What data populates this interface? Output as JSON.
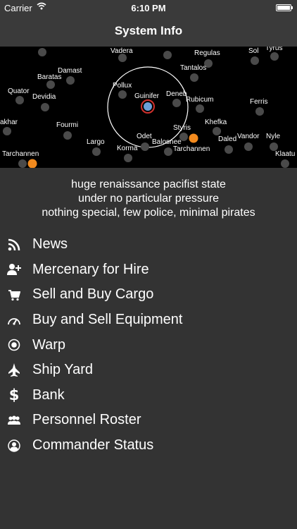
{
  "status_bar": {
    "carrier": "Carrier",
    "time": "6:10 PM",
    "wifi_icon": "wifi-icon",
    "battery_icon": "battery-icon"
  },
  "nav": {
    "title": "System Info"
  },
  "map": {
    "current_system": "Guinifer",
    "systems": [
      {
        "name": "Vadera"
      },
      {
        "name": "Regulas"
      },
      {
        "name": "Sol"
      },
      {
        "name": "Tyrus"
      },
      {
        "name": "Damast"
      },
      {
        "name": "Baratas"
      },
      {
        "name": "Tantalos"
      },
      {
        "name": "Pollux"
      },
      {
        "name": "Quator"
      },
      {
        "name": "Devidia"
      },
      {
        "name": "Guinifer"
      },
      {
        "name": "Deneb"
      },
      {
        "name": "Rubicum"
      },
      {
        "name": "Ferris"
      },
      {
        "name": "akhar"
      },
      {
        "name": "Fourmi"
      },
      {
        "name": "Khefka"
      },
      {
        "name": "Styris"
      },
      {
        "name": "Odet"
      },
      {
        "name": "Vandor"
      },
      {
        "name": "Nyle"
      },
      {
        "name": "Largo"
      },
      {
        "name": "Balosnee"
      },
      {
        "name": "Daled"
      },
      {
        "name": "Korma"
      },
      {
        "name": "Tarchannen"
      },
      {
        "name": "Tarchannen"
      },
      {
        "name": "Klaatu"
      }
    ],
    "colors": {
      "planet": "#4a4a4a",
      "current": "#6a9fd8",
      "current_ring": "#d0312d",
      "wormhole": "#f28a1e",
      "range_ring": "#ffffff"
    }
  },
  "description": {
    "line1": "huge renaissance pacifist state",
    "line2": "under no particular pressure",
    "line3": "nothing special, few police, minimal pirates"
  },
  "menu": [
    {
      "label": "News",
      "icon": "rss-icon"
    },
    {
      "label": "Mercenary for Hire",
      "icon": "add-person-icon"
    },
    {
      "label": "Sell and Buy Cargo",
      "icon": "cart-icon"
    },
    {
      "label": "Buy and Sell Equipment",
      "icon": "gauge-icon"
    },
    {
      "label": "Warp",
      "icon": "warp-target-icon"
    },
    {
      "label": "Ship Yard",
      "icon": "jet-icon"
    },
    {
      "label": "Bank",
      "icon": "dollar-icon"
    },
    {
      "label": "Personnel Roster",
      "icon": "group-icon"
    },
    {
      "label": "Commander Status",
      "icon": "person-icon"
    }
  ]
}
